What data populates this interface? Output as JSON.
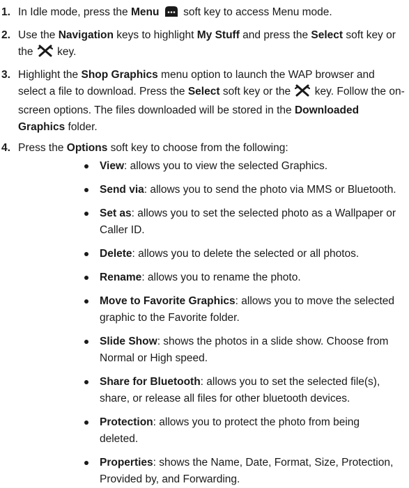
{
  "steps": [
    {
      "num": "1.",
      "parts": [
        {
          "t": "In Idle mode, press the "
        },
        {
          "b": "Menu"
        },
        {
          "t": " "
        },
        {
          "icon": "menu-softkey"
        },
        {
          "t": " soft key to access Menu mode."
        }
      ]
    },
    {
      "num": "2.",
      "parts": [
        {
          "t": "Use the "
        },
        {
          "b": "Navigation"
        },
        {
          "t": " keys to highlight "
        },
        {
          "b": "My Stuff"
        },
        {
          "t": " and press the "
        },
        {
          "b": "Select"
        },
        {
          "t": " soft key or the "
        },
        {
          "icon": "select-key"
        },
        {
          "t": " key."
        }
      ]
    },
    {
      "num": "3.",
      "parts": [
        {
          "t": "Highlight the "
        },
        {
          "b": "Shop Graphics"
        },
        {
          "t": " menu option to launch the WAP browser and select a file to download. Press the "
        },
        {
          "b": "Select"
        },
        {
          "t": " soft key or the "
        },
        {
          "icon": "select-key"
        },
        {
          "t": " key. Follow the on-screen options. The files downloaded will be stored in the "
        },
        {
          "b": "Downloaded Graphics"
        },
        {
          "t": " folder."
        }
      ]
    },
    {
      "num": "4.",
      "parts": [
        {
          "t": "Press the "
        },
        {
          "b": "Options"
        },
        {
          "t": " soft key to choose from the following:"
        }
      ]
    }
  ],
  "options": [
    {
      "term": "View",
      "desc": ": allows you to view the selected Graphics."
    },
    {
      "term": "Send via",
      "desc": ": allows you to send the photo via MMS or Bluetooth."
    },
    {
      "term": "Set as",
      "desc": ": allows you to set the selected photo as a Wallpaper or Caller ID."
    },
    {
      "term": "Delete",
      "desc": ": allows you to delete the selected or all photos."
    },
    {
      "term": "Rename",
      "desc": ": allows you to rename the photo."
    },
    {
      "term": "Move to Favorite Graphics",
      "desc": ": allows you to move the selected graphic to the Favorite folder."
    },
    {
      "term": "Slide Show",
      "desc": ": shows the photos in a slide show. Choose from Normal or High speed."
    },
    {
      "term": "Share for Bluetooth",
      "desc": ": allows you to set the selected file(s), share, or release all files for other bluetooth devices."
    },
    {
      "term": "Protection",
      "desc": ": allows you to protect the photo from being deleted."
    },
    {
      "term": "Properties",
      "desc": ":  shows the Name, Date, Format, Size, Protection, Provided by, and Forwarding."
    }
  ]
}
